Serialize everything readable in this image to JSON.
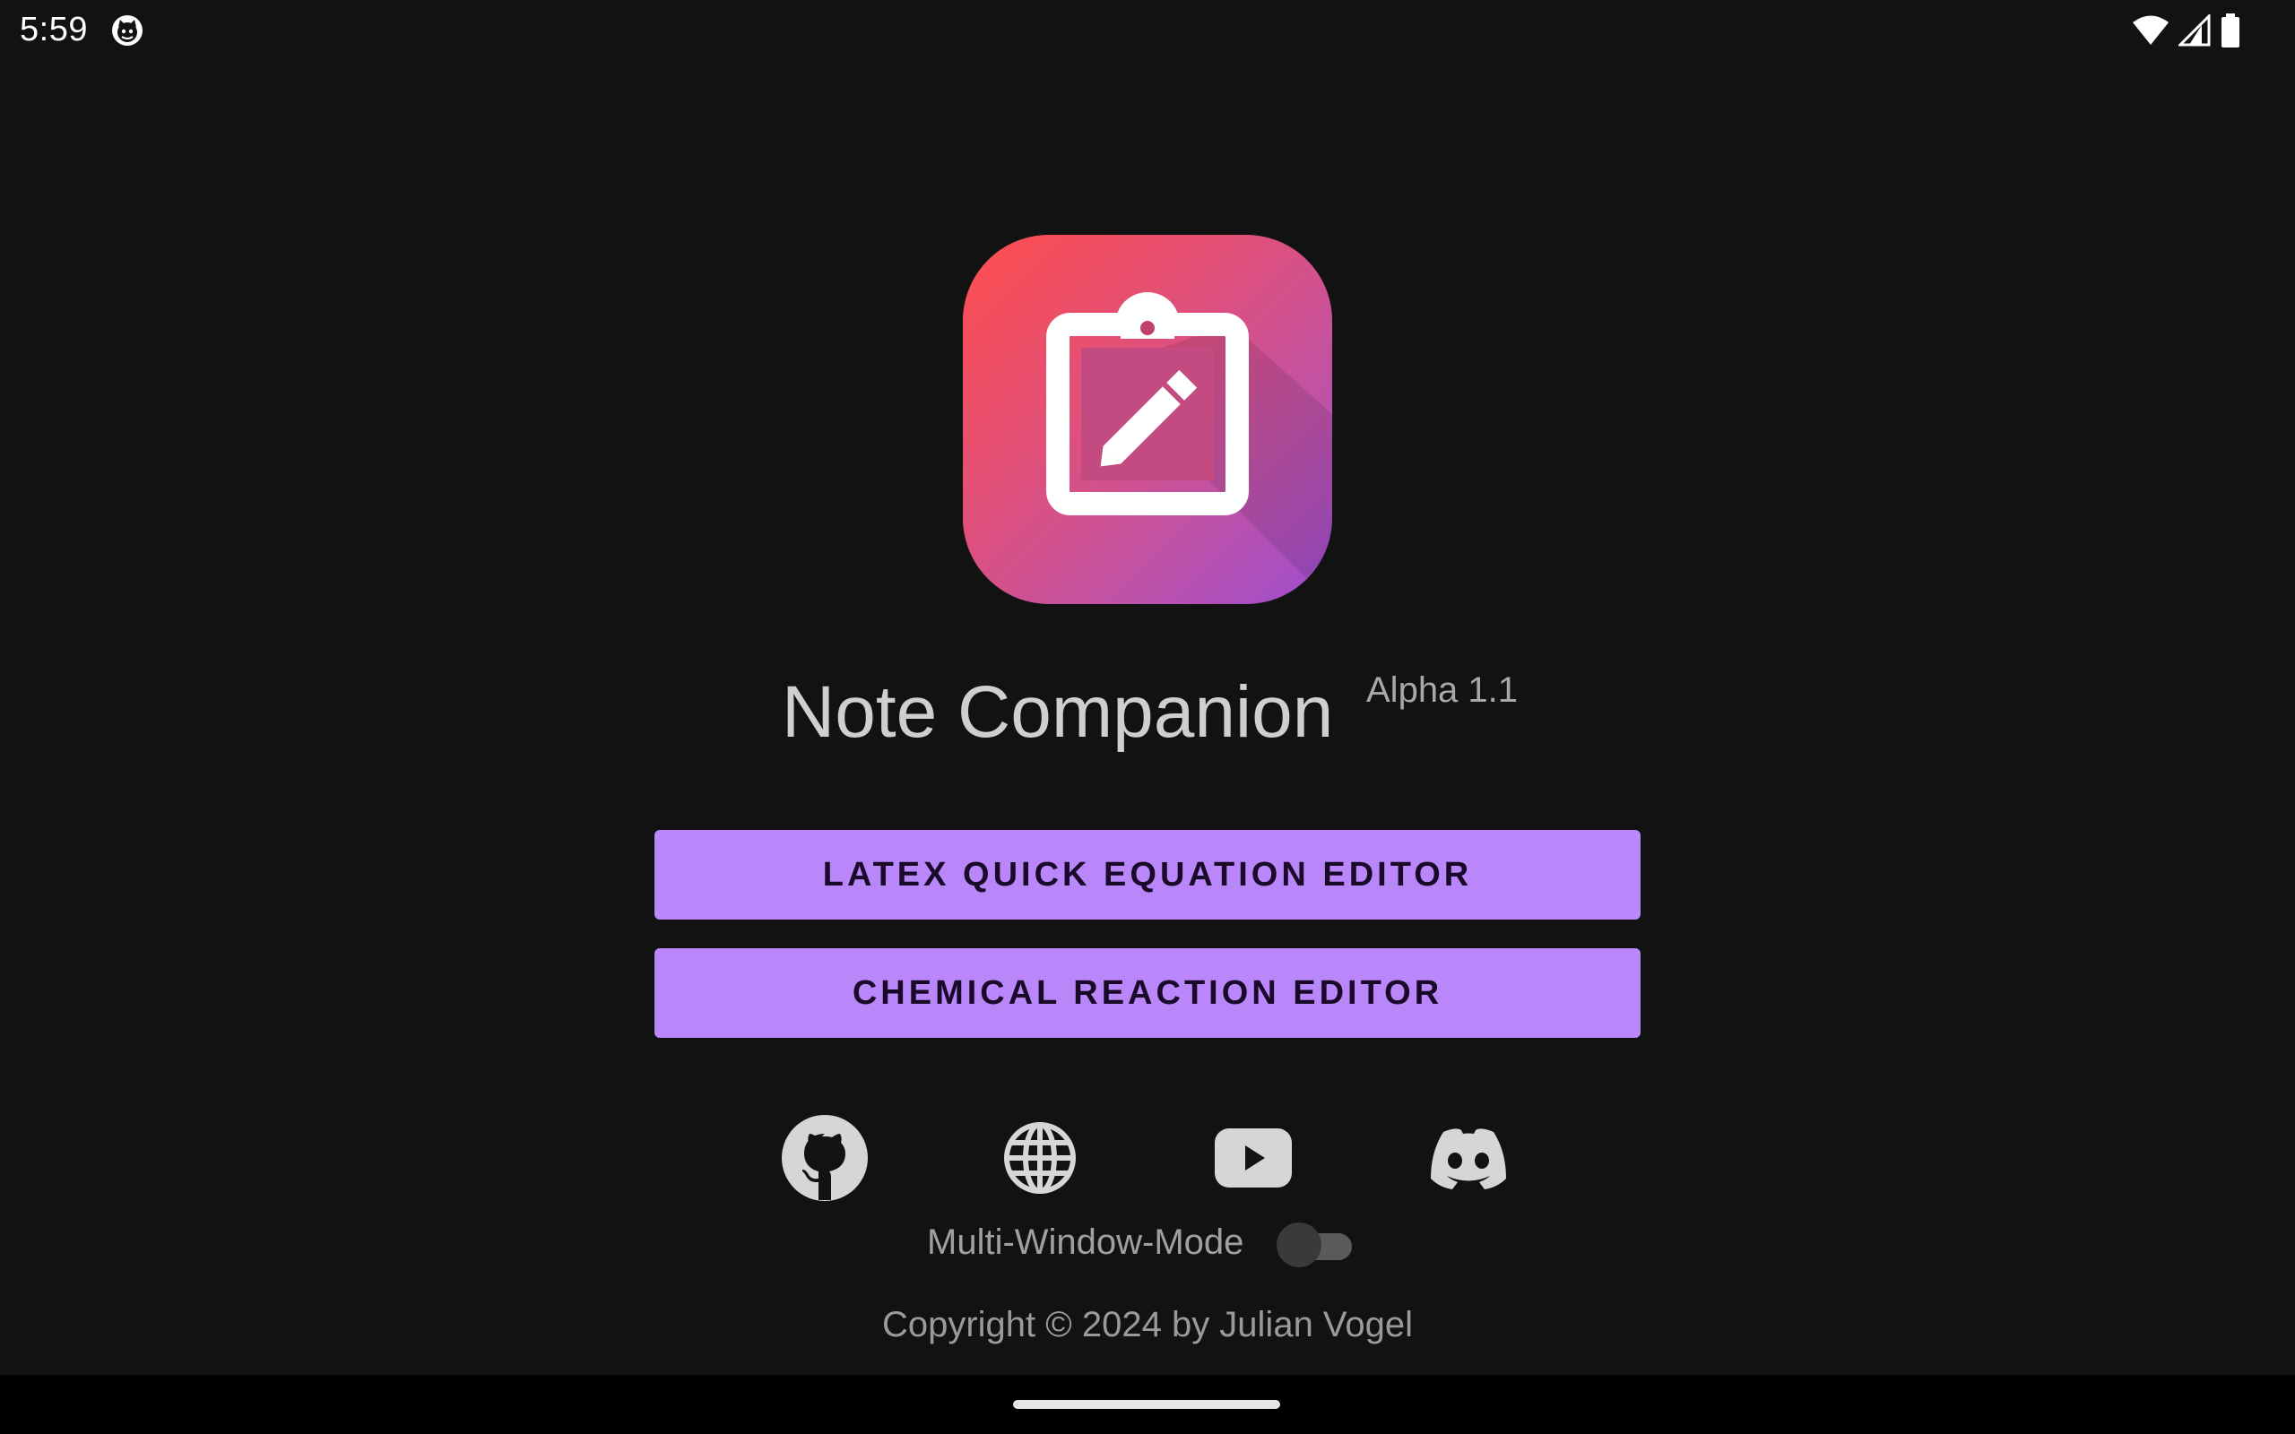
{
  "status_bar": {
    "time": "5:59",
    "notification_icon": "android-cat-icon",
    "wifi_icon": "wifi-icon",
    "signal_icon": "cell-signal-icon",
    "battery_icon": "battery-icon"
  },
  "app": {
    "icon": "clipboard-edit-icon",
    "title": "Note Companion",
    "version": "Alpha 1.1",
    "accent": "#b987fa"
  },
  "buttons": {
    "latex": "LATEX QUICK EQUATION EDITOR",
    "chemical": "CHEMICAL REACTION EDITOR"
  },
  "social": {
    "github": "github-icon",
    "website": "globe-icon",
    "youtube": "youtube-icon",
    "discord": "discord-icon"
  },
  "multi_window": {
    "label": "Multi-Window-Mode",
    "enabled": false
  },
  "footer": {
    "copyright": "Copyright © 2024 by Julian Vogel"
  }
}
